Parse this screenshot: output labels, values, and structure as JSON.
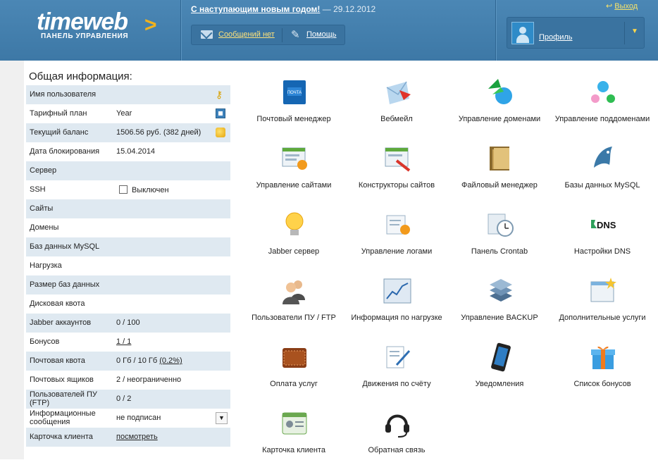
{
  "header": {
    "logo_text": "timeweb",
    "logo_subtitle": "ПАНЕЛЬ УПРАВЛЕНИЯ",
    "news_link": "С наступающим новым годом!",
    "news_date": "— 29.12.2012",
    "messages_link": "Сообщений нет",
    "help_link": "Помощь",
    "exit_link": "Выход",
    "profile_link": "Профиль"
  },
  "info": {
    "title": "Общая информация:",
    "rows": [
      {
        "label": "Имя пользователя",
        "value": ""
      },
      {
        "label": "Тарифный план",
        "value": "Year"
      },
      {
        "label": "Текущий баланс",
        "value": "1506.56 руб. (382 дней)"
      },
      {
        "label": "Дата блокирования",
        "value": "15.04.2014"
      },
      {
        "label": "Сервер",
        "value": ""
      },
      {
        "label": "SSH",
        "value": "Выключен"
      },
      {
        "label": "Сайты",
        "value": ""
      },
      {
        "label": "Домены",
        "value": ""
      },
      {
        "label": "Баз данных MySQL",
        "value": ""
      },
      {
        "label": "Нагрузка",
        "value": ""
      },
      {
        "label": "Размер баз данных",
        "value": ""
      },
      {
        "label": "Дисковая квота",
        "value": ""
      },
      {
        "label": "Jabber аккаунтов",
        "value": "0 / 100"
      },
      {
        "label": "Бонусов",
        "value": "1 / 1"
      },
      {
        "label": "Почтовая квота",
        "value": "0 Гб / 10 Гб",
        "extra": "(0.2%)"
      },
      {
        "label": "Почтовых ящиков",
        "value": "2 / неограниченно"
      },
      {
        "label": "Пользователей ПУ (FTP)",
        "value": "0 / 2"
      },
      {
        "label": "Информационные сообщения",
        "value": "не подписан"
      },
      {
        "label": "Карточка клиента",
        "value": "посмотреть"
      }
    ]
  },
  "tiles": [
    {
      "label": "Почтовый менеджер",
      "icon": "mail-manager-icon"
    },
    {
      "label": "Вебмейл",
      "icon": "webmail-icon"
    },
    {
      "label": "Управление доменами",
      "icon": "domains-icon"
    },
    {
      "label": "Управление поддоменами",
      "icon": "subdomains-icon"
    },
    {
      "label": "Управление сайтами",
      "icon": "sites-icon"
    },
    {
      "label": "Конструкторы сайтов",
      "icon": "site-builder-icon"
    },
    {
      "label": "Файловый менеджер",
      "icon": "file-manager-icon"
    },
    {
      "label": "Базы данных MySQL",
      "icon": "mysql-icon"
    },
    {
      "label": "Jabber сервер",
      "icon": "jabber-icon"
    },
    {
      "label": "Управление логами",
      "icon": "logs-icon"
    },
    {
      "label": "Панель Crontab",
      "icon": "crontab-icon"
    },
    {
      "label": "Настройки DNS",
      "icon": "dns-icon"
    },
    {
      "label": "Пользователи ПУ / FTP",
      "icon": "users-icon"
    },
    {
      "label": "Информация по нагрузке",
      "icon": "load-chart-icon"
    },
    {
      "label": "Управление BACKUP",
      "icon": "backup-icon"
    },
    {
      "label": "Дополнительные услуги",
      "icon": "extra-services-icon"
    },
    {
      "label": "Оплата услуг",
      "icon": "wallet-icon"
    },
    {
      "label": "Движения по счёту",
      "icon": "account-movements-icon"
    },
    {
      "label": "Уведомления",
      "icon": "phone-icon"
    },
    {
      "label": "Список бонусов",
      "icon": "gift-icon"
    },
    {
      "label": "Карточка клиента",
      "icon": "client-card-icon"
    },
    {
      "label": "Обратная связь",
      "icon": "headset-icon"
    }
  ],
  "dns_icon_text": "DNS",
  "colors": {
    "header": "#4480af",
    "accent": "#f3b31c",
    "row_alt": "#dfe9f1"
  }
}
